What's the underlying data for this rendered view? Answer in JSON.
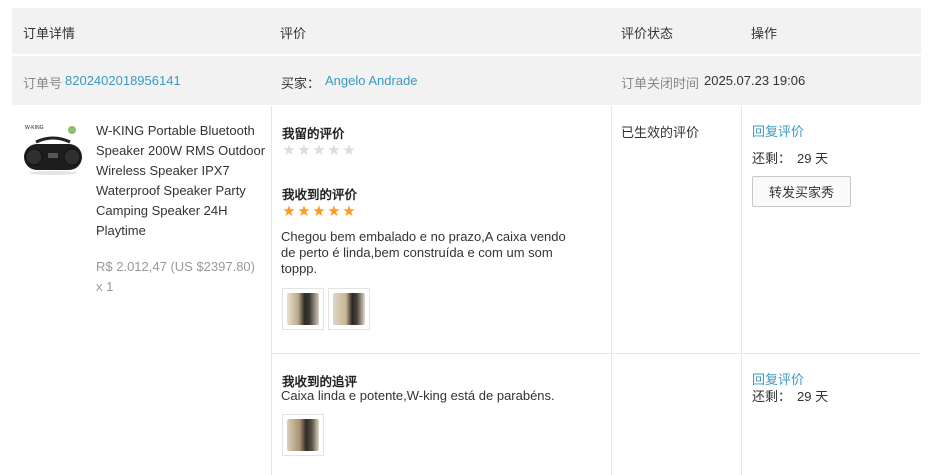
{
  "header": {
    "col_order": "订单详情",
    "col_review": "评价",
    "col_status": "评价状态",
    "col_action": "操作"
  },
  "order": {
    "number_label": "订单号",
    "number": "8202402018956141",
    "buyer_label": "买家：",
    "buyer": "Angelo Andrade",
    "closed_label": "订单关闭时间",
    "closed_time": "2025.07.23 19:06"
  },
  "product": {
    "title": "W-KING Portable Bluetooth Speaker 200W RMS Outdoor Wireless Speaker IPX7 Waterproof Speaker Party Camping Speaker 24H Playtime",
    "price": "R$ 2.012,47 (US $2397.80)",
    "quantity": "x 1",
    "image_icon": "speaker-product-image"
  },
  "my_review": {
    "label": "我留的评价",
    "stars": 0
  },
  "received_review": {
    "label": "我收到的评价",
    "stars": 5,
    "text_line1": "Chegou bem embalado e no prazo,A caixa vendo",
    "text_line2": "de perto é linda,bem construída e com um som",
    "text_line3": "toppp.",
    "photo_count": 2
  },
  "follow_review": {
    "label": "我收到的追评",
    "text": "Caixa linda e potente,W-king está de parabéns.",
    "photo_count": 1
  },
  "status": {
    "text": "已生效的评价"
  },
  "actions": {
    "reply_label": "回复评价",
    "remaining_label": "还剩：",
    "remaining_value": "29 天",
    "share_button": "转发买家秀",
    "reply_label_2": "回复评价",
    "remaining_label_2": "还剩：",
    "remaining_value_2": "29 天"
  },
  "colors": {
    "link": "#3b99c2",
    "star": "#ff9a1f",
    "header_bg": "#f2f2f2"
  }
}
